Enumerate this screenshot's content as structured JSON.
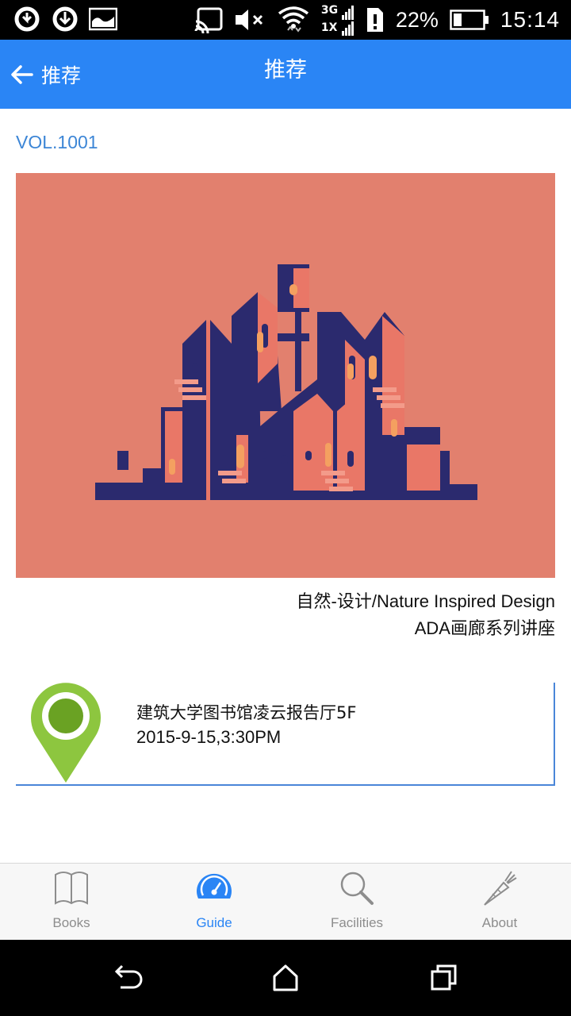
{
  "status_bar": {
    "battery_percent": "22%",
    "time": "15:14",
    "network_top": "3G",
    "network_bottom": "1X"
  },
  "app_bar": {
    "back_label": "推荐",
    "title": "推荐"
  },
  "article": {
    "volume": "VOL.1001",
    "caption_line1": "自然-设计/Nature Inspired Design",
    "caption_line2": "ADA画廊系列讲座"
  },
  "event": {
    "place": "建筑大学图书馆凌云报告厅5F",
    "datetime": "2015-9-15,3:30PM"
  },
  "tabs": [
    {
      "label": "Books",
      "icon": "book-icon",
      "active": false
    },
    {
      "label": "Guide",
      "icon": "speedometer-icon",
      "active": true
    },
    {
      "label": "Facilities",
      "icon": "magnifier-icon",
      "active": false
    },
    {
      "label": "About",
      "icon": "carrot-icon",
      "active": false
    }
  ],
  "colors": {
    "accent": "#2a85f5",
    "cover_background": "#e2806e",
    "pin_green": "#8dc63f",
    "building_navy": "#2b2a6e"
  }
}
